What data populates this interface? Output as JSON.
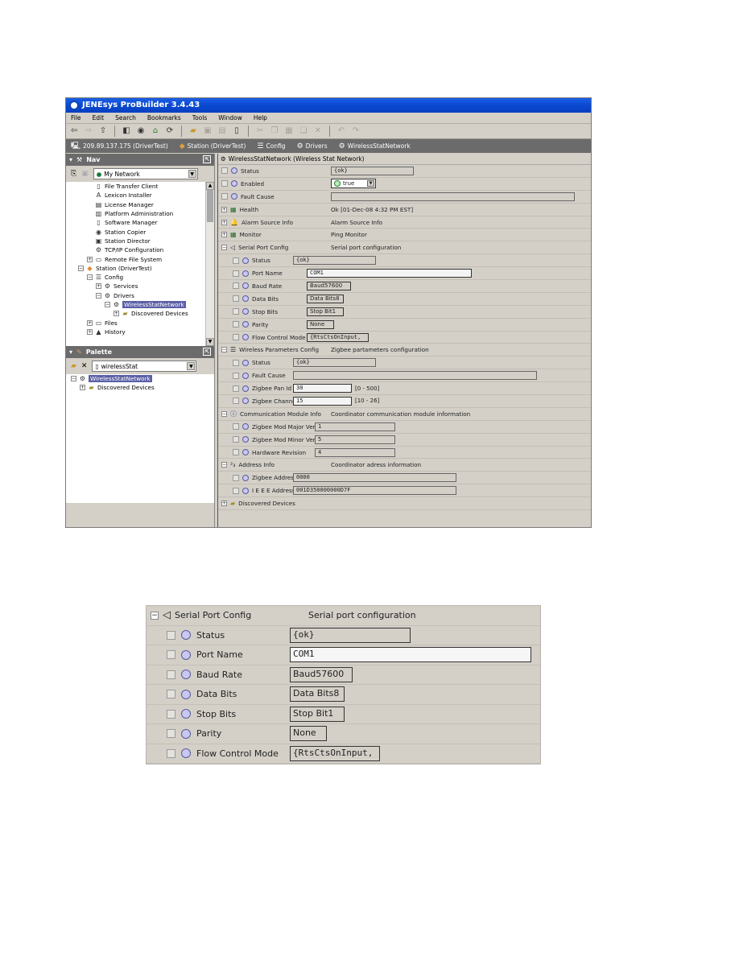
{
  "window": {
    "title": "JENEsys ProBuilder 3.4.43",
    "menu": [
      "File",
      "Edit",
      "Search",
      "Bookmarks",
      "Tools",
      "Window",
      "Help"
    ],
    "toolbar_icons": [
      "back-icon",
      "forward-icon",
      "up-icon",
      "side-bar-icon",
      "refresh-icon",
      "home-icon",
      "sync-icon",
      "open-folder-icon",
      "save-icon",
      "save-all-icon",
      "export-icon",
      "cut-icon",
      "copy-icon",
      "paste-icon",
      "duplicate-icon",
      "delete-icon",
      "undo-icon",
      "redo-icon"
    ]
  },
  "pathbar": [
    {
      "label": "209.89.137.175 (DriverTest)",
      "icon": "computer-icon"
    },
    {
      "label": "Station (DriverTest)",
      "icon": "station-icon"
    },
    {
      "label": "Config",
      "icon": "config-icon"
    },
    {
      "label": "Drivers",
      "icon": "drivers-icon"
    },
    {
      "label": "WirelessStatNetwork",
      "icon": "network-icon"
    }
  ],
  "nav": {
    "title": "Nav",
    "combo_value": "My Network",
    "tree": [
      {
        "label": "File Transfer Client",
        "level": 2,
        "icon": "file-icon"
      },
      {
        "label": "Lexicon Installer",
        "level": 2,
        "icon": "lexicon-icon"
      },
      {
        "label": "License Manager",
        "level": 2,
        "icon": "license-icon"
      },
      {
        "label": "Platform Administration",
        "level": 2,
        "icon": "platform-icon"
      },
      {
        "label": "Software Manager",
        "level": 2,
        "icon": "software-icon"
      },
      {
        "label": "Station Copier",
        "level": 2,
        "icon": "copier-icon"
      },
      {
        "label": "Station Director",
        "level": 2,
        "icon": "director-icon"
      },
      {
        "label": "TCP/IP Configuration",
        "level": 2,
        "icon": "tcpip-icon"
      },
      {
        "label": "Remote File System",
        "level": 2,
        "icon": "drive-icon",
        "expander": "+"
      },
      {
        "label": "Station (DriverTest)",
        "level": 1,
        "icon": "station-icon",
        "expander": "-"
      },
      {
        "label": "Config",
        "level": 2,
        "icon": "config-icon",
        "expander": "-"
      },
      {
        "label": "Services",
        "level": 3,
        "icon": "services-icon",
        "expander": "+"
      },
      {
        "label": "Drivers",
        "level": 3,
        "icon": "drivers-icon",
        "expander": "-"
      },
      {
        "label": "WirelessStatNetwork",
        "level": 4,
        "icon": "network-icon",
        "expander": "-",
        "selected": true
      },
      {
        "label": "Discovered Devices",
        "level": 5,
        "icon": "folder-icon",
        "expander": "+"
      },
      {
        "label": "Files",
        "level": 2,
        "icon": "drive-icon",
        "expander": "+"
      },
      {
        "label": "History",
        "level": 2,
        "icon": "history-icon",
        "expander": "+"
      }
    ]
  },
  "palette": {
    "title": "Palette",
    "combo_value": "wirelessStat",
    "tree": [
      {
        "label": "WirelessStatNetwork",
        "level": 0,
        "icon": "network-icon",
        "expander": "-",
        "selected": true
      },
      {
        "label": "Discovered Devices",
        "level": 1,
        "icon": "folder-icon",
        "expander": "+"
      }
    ]
  },
  "sheet": {
    "title": "WirelessStatNetwork  (Wireless Stat Network)",
    "rows": [
      {
        "label": "Status",
        "kind": "prop",
        "value": "{ok}",
        "field": "grey"
      },
      {
        "label": "Enabled",
        "kind": "enum",
        "value": "true"
      },
      {
        "label": "Fault Cause",
        "kind": "prop",
        "value": "",
        "field": "grey"
      },
      {
        "label": "Health",
        "kind": "folder",
        "icon": "health-icon",
        "expander": "+",
        "value": "Ok [01-Dec-08 4:32 PM EST]"
      },
      {
        "label": "Alarm Source Info",
        "kind": "folder",
        "icon": "alarm-icon",
        "expander": "+",
        "value": "Alarm Source Info"
      },
      {
        "label": "Monitor",
        "kind": "folder",
        "icon": "monitor-icon",
        "expander": "+",
        "value": "Ping Monitor"
      },
      {
        "label": "Serial Port Config",
        "kind": "folder",
        "icon": "serial-port-icon",
        "expander": "-",
        "value": "Serial port configuration"
      },
      {
        "label": "Status",
        "kind": "prop",
        "indent": 1,
        "value": "{ok}",
        "field": "grey"
      },
      {
        "label": "Port Name",
        "kind": "prop",
        "indent": 1,
        "value": "COM1",
        "field": "white"
      },
      {
        "label": "Baud Rate",
        "kind": "prop",
        "indent": 1,
        "value": "Baud57600",
        "field": "enum"
      },
      {
        "label": "Data Bits",
        "kind": "prop",
        "indent": 1,
        "value": "Data Bits8",
        "field": "enum"
      },
      {
        "label": "Stop Bits",
        "kind": "prop",
        "indent": 1,
        "value": "Stop Bit1",
        "field": "enum"
      },
      {
        "label": "Parity",
        "kind": "prop",
        "indent": 1,
        "value": "None",
        "field": "enum"
      },
      {
        "label": "Flow Control Mode",
        "kind": "prop",
        "indent": 1,
        "value": "{RtsCtsOnInput,",
        "field": "enum"
      },
      {
        "label": "Wireless Parameters Config",
        "kind": "folder",
        "icon": "wireless-params-icon",
        "expander": "-",
        "value": "Zigbee partameters configuration"
      },
      {
        "label": "Status",
        "kind": "prop",
        "indent": 1,
        "value": "{ok}",
        "field": "grey"
      },
      {
        "label": "Fault Cause",
        "kind": "prop",
        "indent": 1,
        "value": "",
        "field": "grey"
      },
      {
        "label": "Zigbee Pan Id",
        "kind": "prop",
        "indent": 1,
        "value": "30",
        "field": "white",
        "range": "[0 - 500]"
      },
      {
        "label": "Zigbee Channel",
        "kind": "prop",
        "indent": 1,
        "value": "15",
        "field": "white",
        "range": "[10 - 26]"
      },
      {
        "label": "Communication Module Info",
        "kind": "folder",
        "icon": "info-icon",
        "expander": "-",
        "value": "Coordinator communication module information"
      },
      {
        "label": "Zigbee Mod Major Version",
        "kind": "prop",
        "indent": 1,
        "value": "1",
        "field": "grey"
      },
      {
        "label": "Zigbee Mod Minor Version",
        "kind": "prop",
        "indent": 1,
        "value": "5",
        "field": "grey"
      },
      {
        "label": "Hardware Revision",
        "kind": "prop",
        "indent": 1,
        "value": "4",
        "field": "grey"
      },
      {
        "label": "Address Info",
        "kind": "folder",
        "icon": "address-icon",
        "expander": "-",
        "value": "Coordinator adress information"
      },
      {
        "label": "Zigbee Address",
        "kind": "prop",
        "indent": 1,
        "value": "0000",
        "field": "grey"
      },
      {
        "label": "I E E E Address",
        "kind": "prop",
        "indent": 1,
        "value": "001D350000000D7F",
        "field": "grey"
      },
      {
        "label": "Discovered Devices",
        "kind": "folder",
        "icon": "folder-icon",
        "expander": "+",
        "value": ""
      }
    ]
  },
  "detail": {
    "header": {
      "label": "Serial Port Config",
      "value": "Serial port configuration"
    },
    "rows": [
      {
        "label": "Status",
        "value": "{ok}"
      },
      {
        "label": "Port Name",
        "value": "COM1"
      },
      {
        "label": "Baud Rate",
        "value": "Baud57600"
      },
      {
        "label": "Data Bits",
        "value": "Data Bits8"
      },
      {
        "label": "Stop Bits",
        "value": "Stop Bit1"
      },
      {
        "label": "Parity",
        "value": "None"
      },
      {
        "label": "Flow Control Mode",
        "value": "{RtsCtsOnInput,"
      }
    ]
  }
}
